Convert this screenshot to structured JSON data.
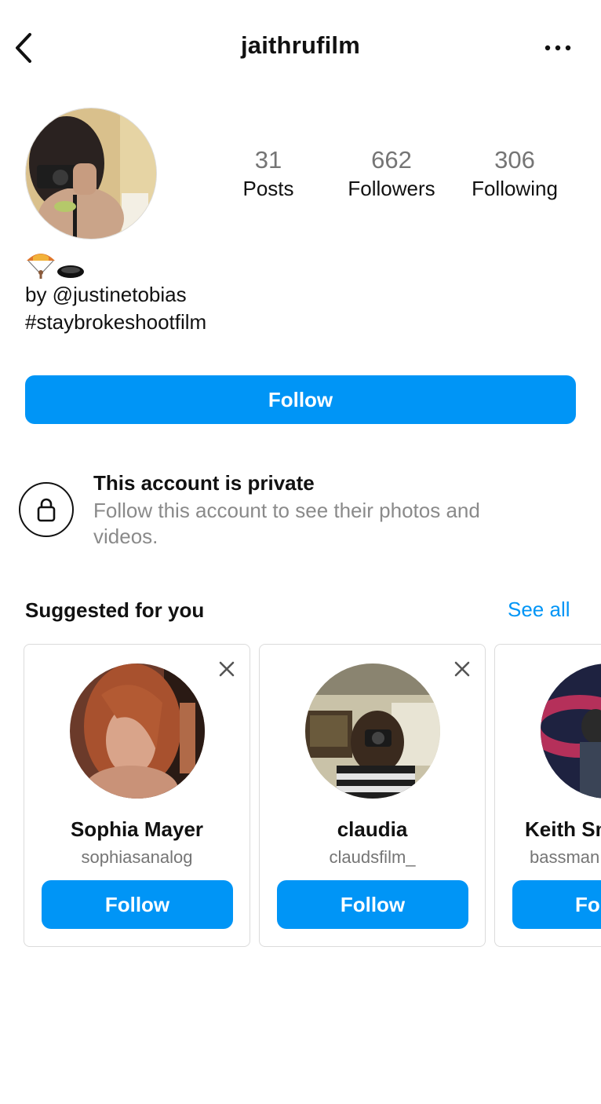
{
  "header": {
    "username": "jaithrufilm",
    "back_icon": "chevron-left-icon",
    "more_icon": "more-horizontal-icon"
  },
  "profile": {
    "stats": [
      {
        "value": "31",
        "label": "Posts"
      },
      {
        "value": "662",
        "label": "Followers"
      },
      {
        "value": "306",
        "label": "Following"
      }
    ],
    "bio_emoji": "🪂🕳",
    "bio_lines": [
      "by @justinetobias",
      "#staybrokeshootfilm"
    ],
    "follow_label": "Follow"
  },
  "private_notice": {
    "icon": "lock-icon",
    "title": "This account is private",
    "description": "Follow this account to see their photos and videos."
  },
  "suggested": {
    "title": "Suggested for you",
    "see_all_label": "See all",
    "cards": [
      {
        "name": "Sophia Mayer",
        "handle": "sophiasanalog",
        "follow_label": "Follow"
      },
      {
        "name": "claudia",
        "handle": "claudsfilm_",
        "follow_label": "Follow"
      },
      {
        "name": "Keith Sm",
        "handle": "bassman",
        "follow_label": "Fo"
      }
    ]
  },
  "colors": {
    "accent": "#0095f6",
    "muted_text": "#757575",
    "border": "#dbdbdb"
  }
}
